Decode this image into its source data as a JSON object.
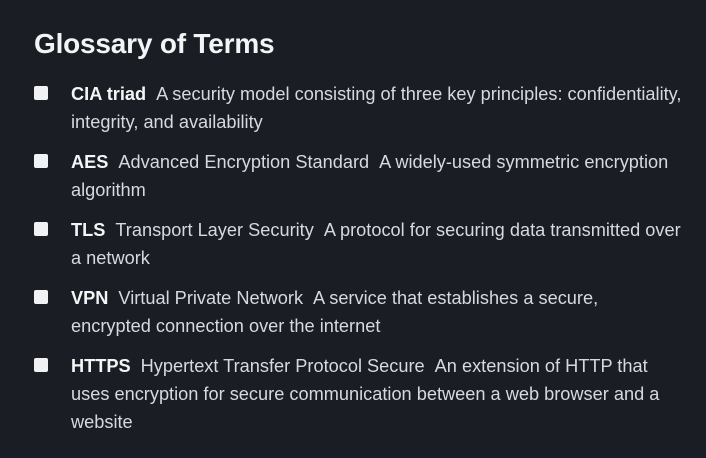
{
  "title": "Glossary of Terms",
  "terms": [
    {
      "term": "CIA triad",
      "expansion": "",
      "description": "A security model consisting of three key principles: confidentiality, integrity, and availability"
    },
    {
      "term": "AES",
      "expansion": "Advanced Encryption Standard",
      "description": "A widely-used symmetric encryption algorithm"
    },
    {
      "term": "TLS",
      "expansion": "Transport Layer Security",
      "description": "A protocol for securing data transmitted over a network"
    },
    {
      "term": "VPN",
      "expansion": "Virtual Private Network",
      "description": "A service that establishes a secure, encrypted connection over the internet"
    },
    {
      "term": "HTTPS",
      "expansion": "Hypertext Transfer Protocol Secure",
      "description": "An extension of HTTP that uses encryption for secure communication between a web browser and a website"
    }
  ],
  "colors": {
    "background": "#1a1d23",
    "text": "#d6d9de",
    "heading": "#f3f4f6",
    "bullet": "#f1f2f4"
  }
}
